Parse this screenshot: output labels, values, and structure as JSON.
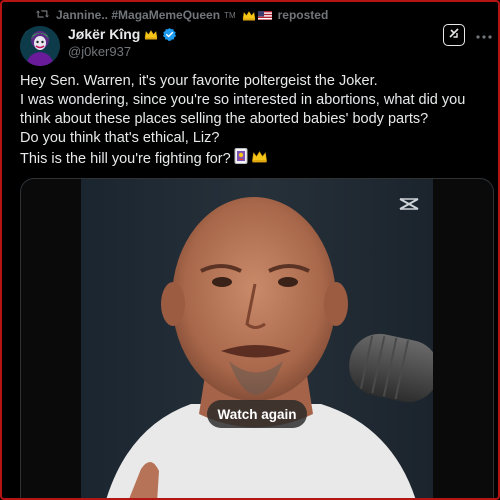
{
  "repost_bar": {
    "reposter": "Jannine.. #MagaMemeQueen",
    "tm": "TM",
    "action": "reposted"
  },
  "author": {
    "display_name": "Jøkër Kîng",
    "handle": "@j0ker937",
    "verified": true
  },
  "tweet": {
    "lines": [
      "Hey Sen. Warren, it's your favorite poltergeist the Joker.",
      "I was wondering, since you're so interested in abortions, what did you",
      "think about these places selling the aborted babies' body parts?",
      "Do you think that's ethical, Liz?",
      "This is the hill you're fighting for?"
    ]
  },
  "media": {
    "button_label": "Watch again",
    "watermark_icon": "capcut-icon"
  },
  "colors": {
    "background": "#000000",
    "text": "#e7e9ea",
    "muted": "#71767b",
    "verified": "#1d9bf0",
    "frame_border": "#b31414"
  },
  "icons": [
    "repost-icon",
    "crown-icon",
    "us-flag-icon",
    "verified-badge-icon",
    "grok-icon",
    "more-icon",
    "playing-card-icon",
    "capcut-icon"
  ]
}
